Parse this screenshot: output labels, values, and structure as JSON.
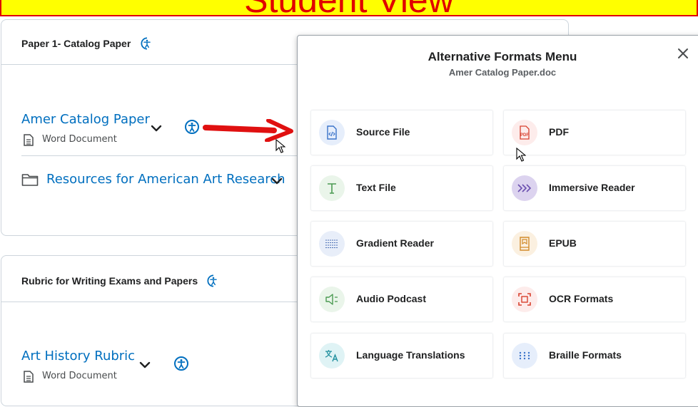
{
  "banner": {
    "text": "Student View"
  },
  "section1": {
    "title": "Paper 1- Catalog Paper",
    "items": [
      {
        "title": "Amer Catalog Paper",
        "type": "Word Document"
      },
      {
        "title": "Resources for American Art Research"
      }
    ]
  },
  "section2": {
    "title": "Rubric for Writing Exams and Papers",
    "items": [
      {
        "title": "Art History Rubric",
        "type": "Word Document"
      }
    ]
  },
  "modal": {
    "title": "Alternative Formats Menu",
    "subtitle": "Amer Catalog Paper.doc",
    "options": [
      {
        "label": "Source File",
        "icon": "code-file-icon",
        "color": "#3a73c9",
        "bg": "#e6eefb"
      },
      {
        "label": "PDF",
        "icon": "pdf-icon",
        "color": "#d8412f",
        "bg": "#fdeceb"
      },
      {
        "label": "Text File",
        "icon": "text-t-icon",
        "color": "#4b9a52",
        "bg": "#eaf5ea"
      },
      {
        "label": "Immersive Reader",
        "icon": "chevrons-icon",
        "color": "#6b4fb0",
        "bg": "#dcd3ef"
      },
      {
        "label": "Gradient Reader",
        "icon": "gradient-lines-icon",
        "color": "#4b6fb5",
        "bg": "#e8eef9"
      },
      {
        "label": "EPUB",
        "icon": "book-icon",
        "color": "#d28b2b",
        "bg": "#fbf0e0"
      },
      {
        "label": "Audio Podcast",
        "icon": "speaker-icon",
        "color": "#4b9a52",
        "bg": "#eaf5ea"
      },
      {
        "label": "OCR Formats",
        "icon": "ocr-scan-icon",
        "color": "#d8412f",
        "bg": "#fdeceb"
      },
      {
        "label": "Language Translations",
        "icon": "translate-icon",
        "color": "#1f8f9e",
        "bg": "#dff3f5"
      },
      {
        "label": "Braille Formats",
        "icon": "braille-dots-icon",
        "color": "#3a73c9",
        "bg": "#e6eefb"
      }
    ]
  }
}
